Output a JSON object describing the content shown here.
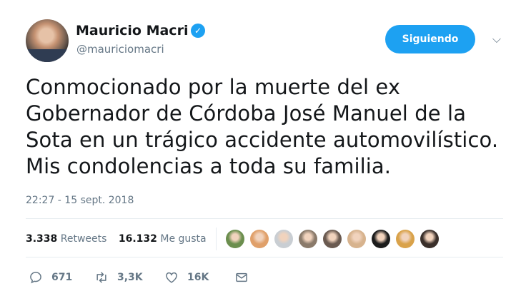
{
  "author": {
    "name": "Mauricio Macri",
    "handle": "@mauriciomacri",
    "verified_badge": "✓"
  },
  "follow_button": {
    "label": "Siguiendo"
  },
  "menu_caret": {
    "glyph": "⌵"
  },
  "tweet": {
    "lines": [
      "Conmocionado por la muerte del ex",
      "Gobernador de Córdoba José Manuel de la",
      "Sota en un trágico accidente automovilístico.",
      "Mis condolencias a toda su familia."
    ],
    "timestamp": "22:27 - 15 sept. 2018"
  },
  "stats": {
    "retweets_count": "3.338",
    "retweets_label": "Retweets",
    "likes_count": "16.132",
    "likes_label": "Me gusta"
  },
  "likers": [
    {
      "name": "liker-avatar",
      "color": "#6b8e4e"
    },
    {
      "name": "liker-avatar",
      "color": "#e0a06a"
    },
    {
      "name": "liker-avatar",
      "color": "#c9ced3"
    },
    {
      "name": "liker-avatar",
      "color": "#8a7a6a"
    },
    {
      "name": "liker-avatar",
      "color": "#6a5a50"
    },
    {
      "name": "liker-avatar",
      "color": "#d7b38e"
    },
    {
      "name": "liker-avatar",
      "color": "#1c1c1c"
    },
    {
      "name": "liker-avatar",
      "color": "#d9a24a"
    },
    {
      "name": "liker-avatar",
      "color": "#3a2f2a"
    }
  ],
  "actions": {
    "reply_count": "671",
    "retweet_count": "3,3K",
    "like_count": "16K"
  },
  "colors": {
    "accent": "#1da1f2",
    "text": "#14171a",
    "muted": "#657786",
    "divider": "#e6ecf0"
  }
}
